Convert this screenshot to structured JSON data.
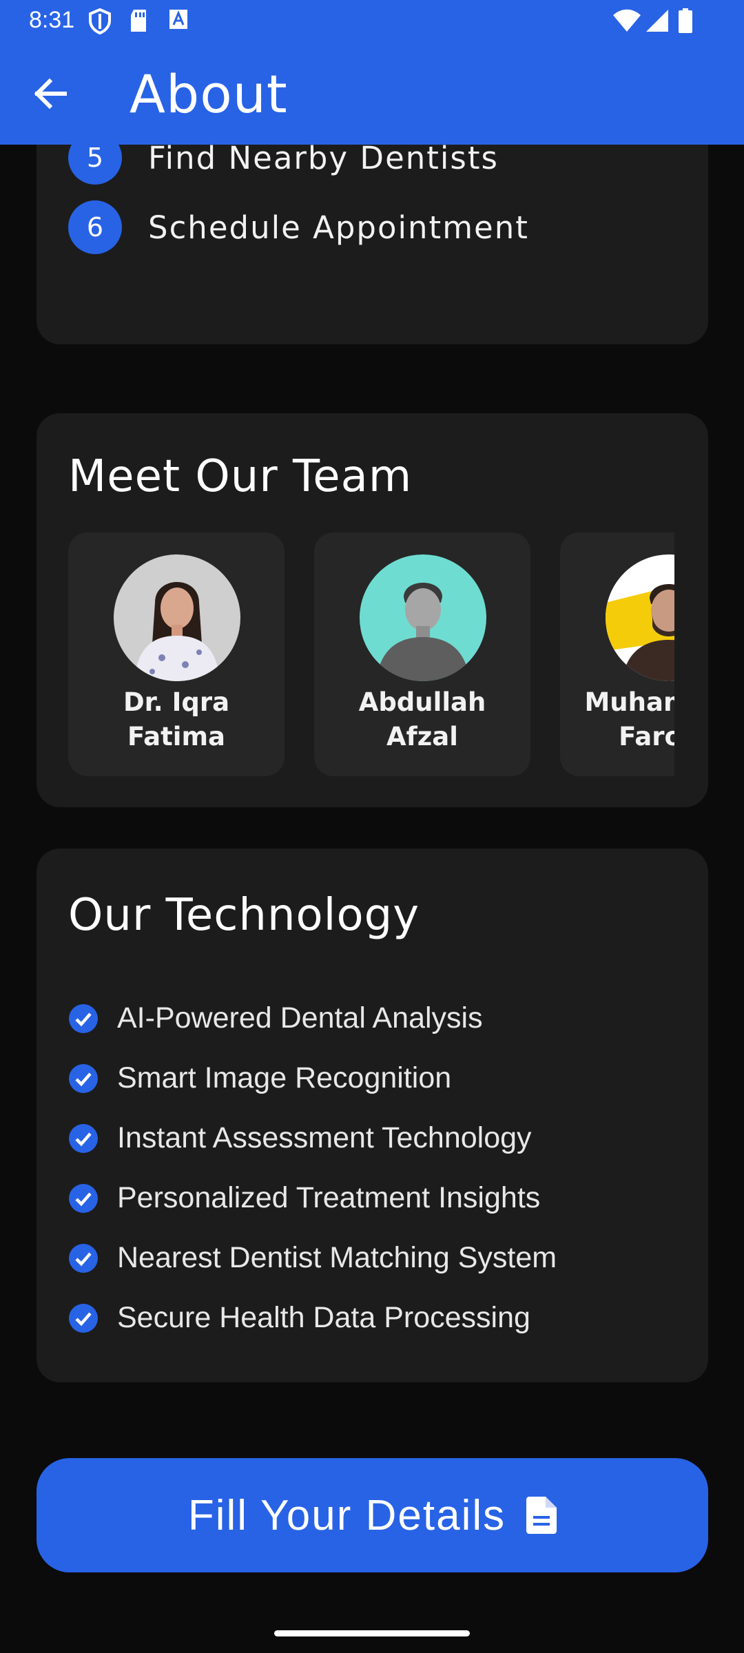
{
  "status": {
    "time": "8:31",
    "left_icons": [
      "shield-icon",
      "sd-card-icon",
      "translate-icon"
    ],
    "right_icons": [
      "wifi-icon",
      "signal-icon",
      "battery-icon"
    ]
  },
  "appbar": {
    "title": "About",
    "back_icon": "arrow-back-icon"
  },
  "steps": [
    {
      "number": "5",
      "label": "Find Nearby Dentists"
    },
    {
      "number": "6",
      "label": "Schedule Appointment"
    }
  ],
  "team": {
    "title": "Meet Our Team",
    "members": [
      {
        "name": "Dr. Iqra\nFatima"
      },
      {
        "name": "Abdullah\nAfzal"
      },
      {
        "name": "Muhammad\nFarooq"
      }
    ]
  },
  "technology": {
    "title": "Our Technology",
    "items": [
      "AI-Powered Dental Analysis",
      "Smart Image Recognition",
      "Instant Assessment Technology",
      "Personalized Treatment Insights",
      "Nearest Dentist Matching System",
      "Secure Health Data Processing"
    ]
  },
  "cta": {
    "label": "Fill Your Details",
    "icon": "document-icon"
  },
  "colors": {
    "accent": "#2863e6",
    "background": "#0b0b0b",
    "card": "#1c1c1c",
    "member_card": "#262626"
  }
}
